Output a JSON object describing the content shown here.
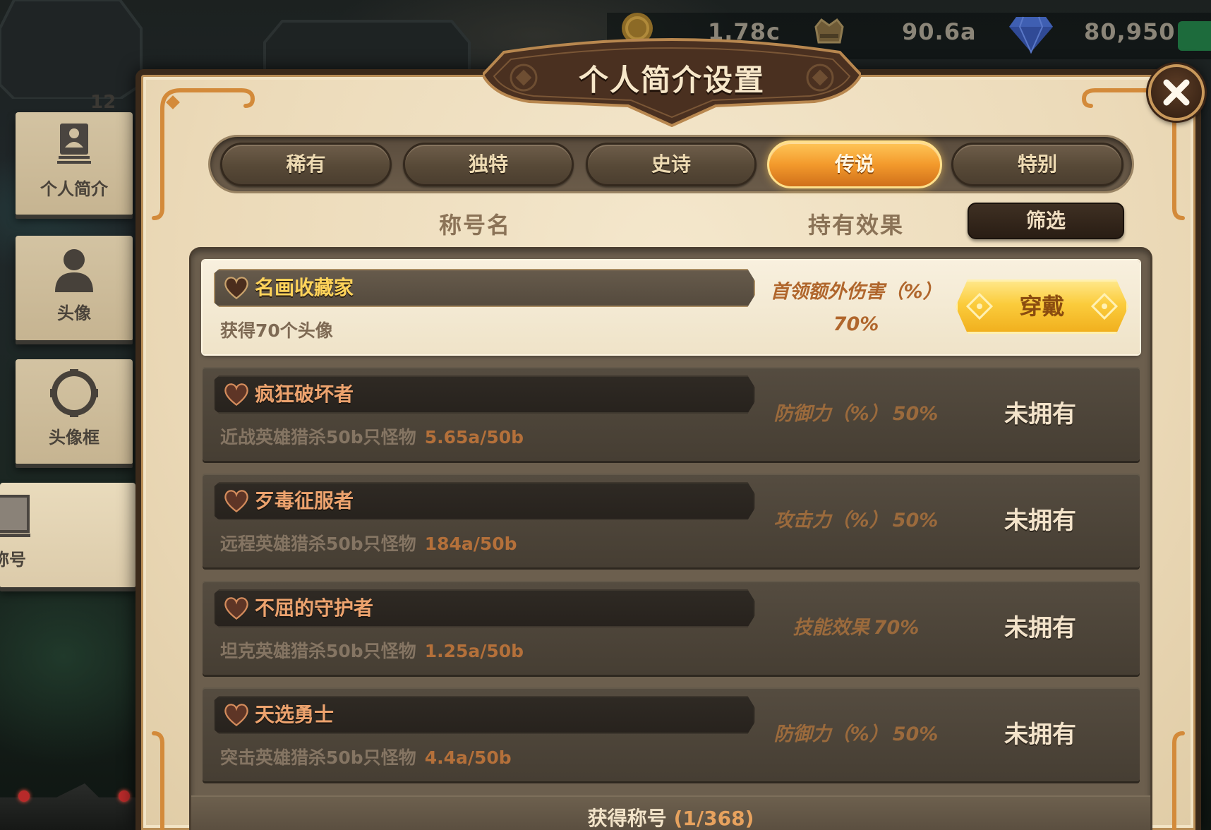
{
  "currency": {
    "gold_icon": "gold-coin-icon",
    "gold_amount": "1.78c",
    "secondary_icon": "crown-chest-icon",
    "secondary_amount": "90.6a",
    "gem_icon": "blue-diamond-icon",
    "gem_amount": "80,950"
  },
  "side_panel": {
    "badge": "12",
    "tabs": [
      {
        "label": "个人简介",
        "icon": "profile-card-icon",
        "selected": false
      },
      {
        "label": "头像",
        "icon": "person-silhouette-icon",
        "selected": false
      },
      {
        "label": "头像框",
        "icon": "avatar-frame-icon",
        "selected": false
      },
      {
        "label": "称号",
        "icon": "title-card-icon",
        "selected": true
      }
    ]
  },
  "dialog": {
    "title": "个人简介设置",
    "close_icon": "close-icon",
    "rarity_tabs": [
      {
        "label": "稀有",
        "selected": false
      },
      {
        "label": "独特",
        "selected": false
      },
      {
        "label": "史诗",
        "selected": false
      },
      {
        "label": "传说",
        "selected": true
      },
      {
        "label": "特别",
        "selected": false
      }
    ],
    "columns": {
      "title_name": "称号名",
      "effect": "持有效果"
    },
    "filter_button": "筛选",
    "titles": [
      {
        "icon": "heart-icon",
        "name": "名画收藏家",
        "requirement": "获得70个头像",
        "effect": "首领额外伤害（%）",
        "effect_value": "70%",
        "owned": true,
        "action": "穿戴"
      },
      {
        "icon": "heart-icon",
        "name": "疯狂破坏者",
        "requirement": "近战英雄猎杀50b只怪物",
        "progress": "5.65a/50b",
        "effect": "防御力（%）",
        "effect_value": "50%",
        "owned": false,
        "status": "未拥有"
      },
      {
        "icon": "heart-icon",
        "name": "歹毒征服者",
        "requirement": "远程英雄猎杀50b只怪物",
        "progress": "184a/50b",
        "effect": "攻击力（%）",
        "effect_value": "50%",
        "owned": false,
        "status": "未拥有"
      },
      {
        "icon": "heart-icon",
        "name": "不屈的守护者",
        "requirement": "坦克英雄猎杀50b只怪物",
        "progress": "1.25a/50b",
        "effect": "技能效果",
        "effect_value": "70%",
        "owned": false,
        "status": "未拥有"
      },
      {
        "icon": "heart-icon",
        "name": "天选勇士",
        "requirement": "突击英雄猎杀50b只怪物",
        "progress": "4.4a/50b",
        "effect": "防御力（%）",
        "effect_value": "50%",
        "owned": false,
        "status": "未拥有"
      }
    ],
    "footer": {
      "label": "获得称号",
      "count": "(1/368)"
    }
  },
  "colors": {
    "parchment": "#ecdcbc",
    "frame_dark_brown": "#3b2a1b",
    "active_tab_orange": "#f39a2c",
    "wear_button_gold": "#fbcc3c",
    "owned_title_name": "#ffd35a",
    "locked_title_name": "#eda36e",
    "progress_text": "#b4703a",
    "effect_text": "#b0662c"
  }
}
